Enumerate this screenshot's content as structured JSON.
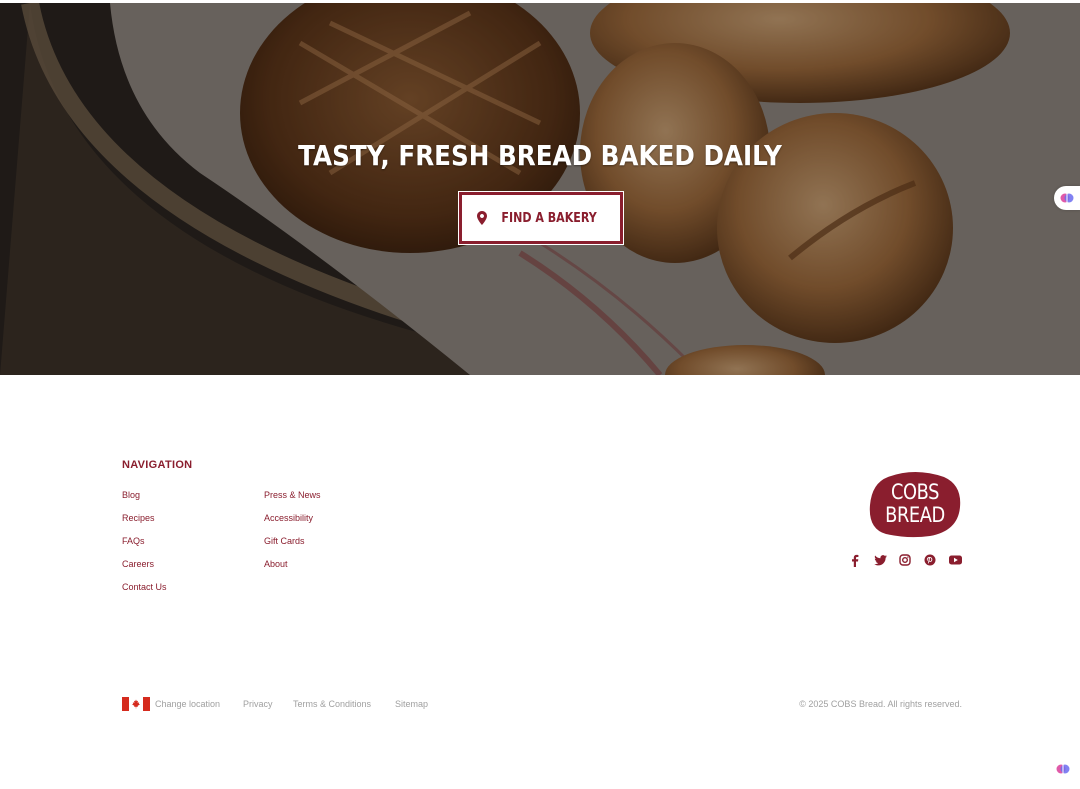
{
  "hero": {
    "title": "TASTY, FRESH BREAD BAKED DAILY",
    "cta_label": "FIND A BAKERY",
    "cta_icon": "map-pin-icon"
  },
  "navigation": {
    "heading": "NAVIGATION",
    "col1": [
      "Blog",
      "Recipes",
      "FAQs",
      "Careers",
      "Contact Us"
    ],
    "col2": [
      "Press & News",
      "Accessibility",
      "Gift Cards",
      "About"
    ]
  },
  "brand": {
    "logo_line1": "COBS",
    "logo_line2": "BREAD",
    "social": [
      "facebook-icon",
      "twitter-icon",
      "instagram-icon",
      "pinterest-icon",
      "youtube-icon"
    ]
  },
  "bottom": {
    "flag": "canada-flag-icon",
    "change_location": "Change location",
    "privacy": "Privacy",
    "terms": "Terms & Conditions",
    "sitemap": "Sitemap",
    "copyright": "© 2025 COBS Bread. All rights reserved."
  },
  "colors": {
    "brand": "#8a1e2e",
    "muted_text": "#a0a0a0"
  }
}
